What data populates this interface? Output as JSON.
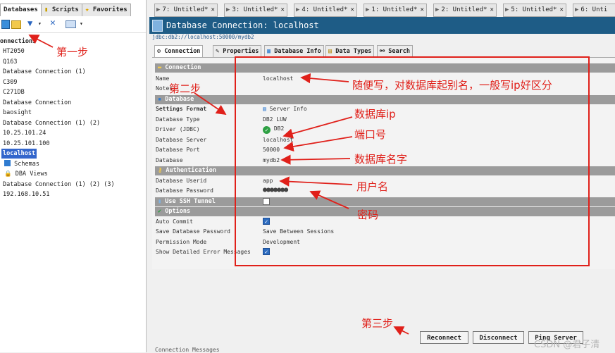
{
  "left_tabs": [
    "Databases",
    "Scripts",
    "Favorites"
  ],
  "tree": [
    "onnections",
    "HT2050",
    "Q163",
    "Database Connection (1)",
    "C309",
    "C271DB",
    "Database Connection",
    "baosight",
    "Database Connection (1) (2)",
    "10.25.101.24",
    "10.25.101.100",
    "localhost",
    "Schemas",
    "DBA Views",
    "Database Connection (1) (2) (3)",
    "192.168.10.51"
  ],
  "editor_tabs": [
    "7: Untitled*",
    "3: Untitled*",
    "4: Untitled*",
    "1: Untitled*",
    "2: Untitled*",
    "5: Untitled*",
    "6: Unti"
  ],
  "header": {
    "title": "Database Connection: localhost",
    "subtitle": "jdbc:db2://localhost:50000/mydb2"
  },
  "panel_tabs": [
    "Connection",
    "Properties",
    "Database Info",
    "Data Types",
    "Search"
  ],
  "sections": {
    "connection": "Connection",
    "database": "Database",
    "authentication": "Authentication",
    "ssh": "Use SSH Tunnel",
    "options": "Options"
  },
  "fields": {
    "name_label": "Name",
    "name_value": "localhost",
    "notes_label": "Notes",
    "settings_label": "Settings Format",
    "settings_value": "Server Info",
    "dbtype_label": "Database Type",
    "dbtype_value": "DB2 LUW",
    "driver_label": "Driver (JDBC)",
    "driver_value": "DB2",
    "server_label": "Database Server",
    "server_value": "localhost",
    "port_label": "Database Port",
    "port_value": "50000",
    "database_label": "Database",
    "database_value": "mydb2",
    "userid_label": "Database Userid",
    "userid_value": "app",
    "password_label": "Database Password",
    "password_value": "●●●●●●●",
    "autocommit_label": "Auto Commit",
    "savepw_label": "Save Database Password",
    "savepw_value": "Save Between Sessions",
    "permission_label": "Permission Mode",
    "permission_value": "Development",
    "showerr_label": "Show Detailed Error Messages"
  },
  "checks": {
    "ssh": false,
    "autocommit": true,
    "showerr": true
  },
  "annotations": {
    "step1": "第一步",
    "step2": "第二步",
    "step3": "第三步",
    "name_note": "随便写，对数据库起别名，一般写ip好区分",
    "ip_note": "数据库ip",
    "port_note": "端口号",
    "dbname_note": "数据库名字",
    "user_note": "用户名",
    "pw_note": "密码"
  },
  "buttons": {
    "reconnect": "Reconnect",
    "disconnect": "Disconnect",
    "ping": "Ping Server"
  },
  "footer_partial": "Connection Messages",
  "watermark": "CSDN @君子清",
  "colors": {
    "annotation_red": "#e0201a",
    "header_blue": "#1e5c86",
    "section_gray": "#9b9b9b",
    "selection_blue": "#3366cc"
  }
}
